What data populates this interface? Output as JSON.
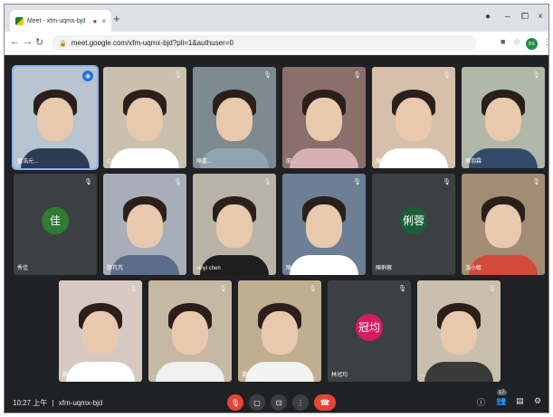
{
  "browser": {
    "tab_title": "Meet - xfm-uqmx-bjd",
    "rec_icon": "●",
    "close_glyph": "×",
    "new_tab_glyph": "+",
    "url": "meet.google.com/xfm-uqmx-bjd?pli=1&authuser=0",
    "profile_initials": "BS",
    "window_controls": [
      "●",
      "–",
      "⧠",
      "×"
    ]
  },
  "participants": [
    {
      "name": "藍浩元…",
      "kind": "video",
      "speaking": true,
      "bg": "#b8c4cf",
      "shirt": "#2d3b55"
    },
    {
      "name": "Cattin Lin",
      "kind": "video",
      "bg": "#c9c0ae",
      "shirt": "#ffffff"
    },
    {
      "name": "陳嘉…",
      "kind": "video",
      "bg": "#7d8a8f",
      "shirt": "#8fa4b0"
    },
    {
      "name": "廖…",
      "kind": "video",
      "bg": "#8a6f6b",
      "shirt": "#d8b0b0"
    },
    {
      "name": "陳筱茹",
      "kind": "video",
      "bg": "#d6c0ac",
      "shirt": "#ffffff"
    },
    {
      "name": "蔡羽霖",
      "kind": "video",
      "bg": "#b0b8a8",
      "shirt": "#334a6b"
    },
    {
      "name": "秀佳",
      "kind": "avatar",
      "letter": "佳",
      "avatar_color": "#2e7d32"
    },
    {
      "name": "鄭芃芃",
      "kind": "video",
      "bg": "#a8aeb8",
      "shirt": "#5c6b8a"
    },
    {
      "name": "sinyi chen",
      "kind": "video",
      "bg": "#b9b2a6",
      "shirt": "#1e1e1e"
    },
    {
      "name": "陳…",
      "kind": "video",
      "bg": "#6c7f95",
      "shirt": "#ffffff"
    },
    {
      "name": "陳俐蓉",
      "kind": "avatar",
      "letter": "俐蓉",
      "avatar_color": "#1b5e3a"
    },
    {
      "name": "溫小敏",
      "kind": "video",
      "bg": "#a28c74",
      "shirt": "#d44a3a"
    },
    {
      "name": "楊乙…",
      "kind": "video",
      "bg": "#d7c8c2",
      "shirt": "#ffffff"
    },
    {
      "name": "…",
      "kind": "video",
      "bg": "#c6b9a3",
      "shirt": "#f0f0f0"
    },
    {
      "name": "蕭振文",
      "kind": "video",
      "bg": "#bfae8f",
      "shirt": "#f2f2f2"
    },
    {
      "name": "林冠均",
      "kind": "avatar",
      "letter": "冠均",
      "avatar_color": "#d81b60"
    },
    {
      "name": "…",
      "kind": "video",
      "bg": "#c9bfae",
      "shirt": "#3a3a3a"
    }
  ],
  "mic_off_glyph": "🎙",
  "mic_on_glyph": "◉",
  "meeting": {
    "time": "10:27 上午",
    "separator": "|",
    "code": "xfm-uqmx-bjd"
  },
  "controls": {
    "mic_glyph": "🎙",
    "camera_glyph": "▢",
    "present_glyph": "⊡",
    "more_glyph": "⋮",
    "hangup_glyph": "☎",
    "info_glyph": "ⓘ",
    "people_glyph": "👥",
    "people_count": "17",
    "chat_glyph": "▤",
    "activities_glyph": "⚙"
  }
}
